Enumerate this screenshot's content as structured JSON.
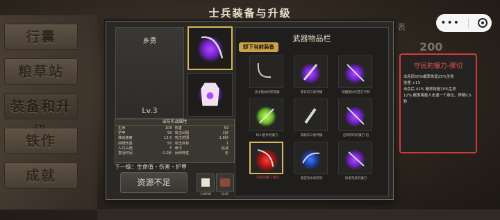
{
  "title": "士兵装备与升级",
  "left_menu": [
    "行囊",
    "粮草站",
    "装备和升级",
    "铁作",
    "成就"
  ],
  "background": {
    "number": "200",
    "char": "表"
  },
  "character": {
    "name": "乡勇",
    "level": "Lv.3"
  },
  "stats": {
    "title": "当前实战属性",
    "rows": [
      [
        "生命",
        "108",
        "伤害",
        "59"
      ],
      [
        "护甲",
        "99",
        "攻击间隔",
        "1秒"
      ],
      [
        "移动速度",
        "13.5",
        "攻击范围",
        "1.8秒"
      ],
      [
        "间隔伤害",
        "50",
        "攻击目标",
        "1"
      ],
      [
        "人口占用",
        "5",
        "命中",
        "近战"
      ],
      [
        "复活时间",
        "0.2秒",
        "兵种特性",
        "无"
      ]
    ]
  },
  "next_level": "下一级：生命值・伤害・护甲",
  "resource_button": "资源不足",
  "resource_items": [
    {
      "icon": "scroll-icon",
      "count": "149/98"
    },
    {
      "icon": "ore-icon",
      "count": "0/49"
    }
  ],
  "inventory": {
    "title": "武器物品栏",
    "unequip_label": "卸下当前装备",
    "items": [
      {
        "label": "流水锻纹的斩铁镰",
        "tag": ""
      },
      {
        "label": "厚背的三厘神镰",
        "tag": ""
      },
      {
        "label": "铭雕锻纹的西方半刺",
        "tag": ""
      },
      {
        "label": "缺少配件的镰刀",
        "tag": ""
      },
      {
        "label": "来路的三厘神镰",
        "tag": ""
      },
      {
        "label": "启风所制的镰刀-恒",
        "tag": ""
      },
      {
        "label": "守民的镰刀-骤切",
        "tag": ""
      },
      {
        "label": "意驭流水的斩铁",
        "tag": ""
      },
      {
        "label": "知者无惑的镰刀",
        "tag": ""
      }
    ]
  },
  "detail": {
    "title": "守民的镰刀-骤切",
    "lines": [
      "击杀后55%概率恢复25%生命",
      "伤害 +13",
      "击杀后 41% 概率恢复15%生命",
      "12% 概率将敌人击退一个身位，停顿0.5秒"
    ]
  },
  "colors": {
    "accent_gold": "#d6b85a",
    "detail_border": "#d33a3a",
    "glow_purple": "#9b3cff",
    "glow_green": "#a8ff3c",
    "glow_red": "#ff2a2a",
    "glow_blue": "#3c7cff"
  }
}
